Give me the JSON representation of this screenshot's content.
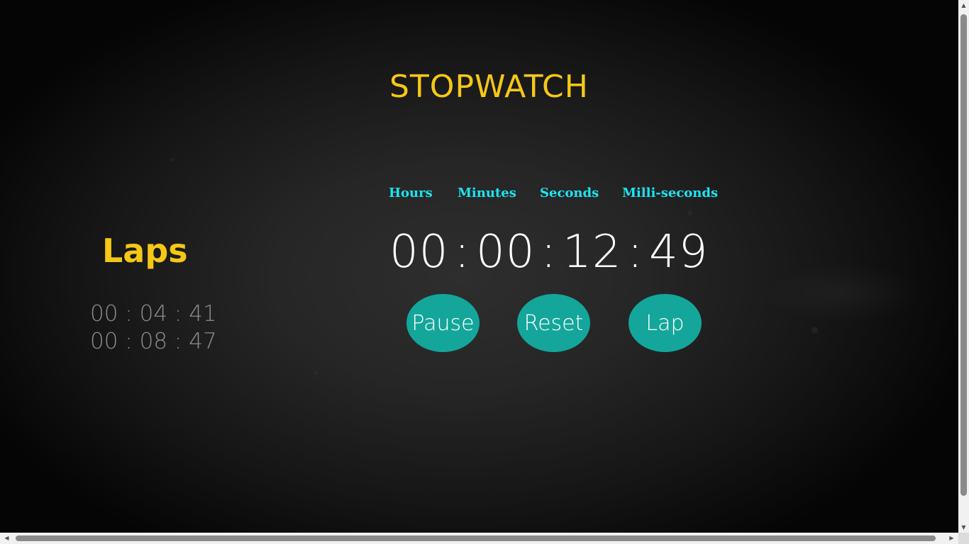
{
  "app": {
    "title": "STOPWATCH"
  },
  "laps": {
    "title": "Laps",
    "entries": [
      "00 : 04 : 41",
      "00 : 08 : 47"
    ]
  },
  "units": {
    "hours": "Hours",
    "minutes": "Minutes",
    "seconds": "Seconds",
    "milliseconds": "Milli-seconds"
  },
  "time": {
    "hours": "00",
    "minutes": "00",
    "seconds": "12",
    "milliseconds": "49",
    "separator": ":"
  },
  "buttons": {
    "pause": "Pause",
    "reset": "Reset",
    "lap": "Lap"
  },
  "scrollbar": {
    "up_icon": "▲",
    "down_icon": "▼",
    "left_icon": "◀",
    "right_icon": "▶"
  },
  "colors": {
    "accent": "#f5c816",
    "unit_label": "#1de4f0",
    "button": "#14a69a",
    "lap_text": "#8c8c8c"
  }
}
